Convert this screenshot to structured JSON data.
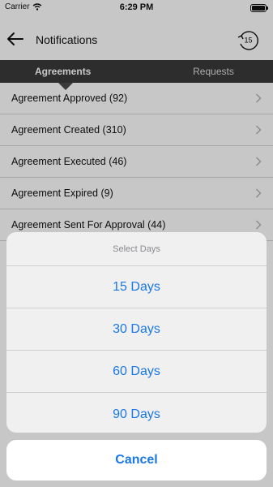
{
  "status_bar": {
    "carrier": "Carrier",
    "time": "6:29 PM"
  },
  "nav": {
    "title": "Notifications",
    "history_days": "15"
  },
  "tabs": [
    {
      "label": "Agreements",
      "active": true
    },
    {
      "label": "Requests",
      "active": false
    }
  ],
  "list": [
    "Agreement Approved (92)",
    "Agreement Created (310)",
    "Agreement Executed (46)",
    "Agreement Expired (9)",
    "Agreement Sent For Approval (44)"
  ],
  "action_sheet": {
    "title": "Select Days",
    "options": [
      "15 Days",
      "30 Days",
      "60 Days",
      "90 Days"
    ],
    "cancel": "Cancel"
  },
  "colors": {
    "accent": "#1a78e6",
    "tab_bar": "#3a3a3a"
  }
}
